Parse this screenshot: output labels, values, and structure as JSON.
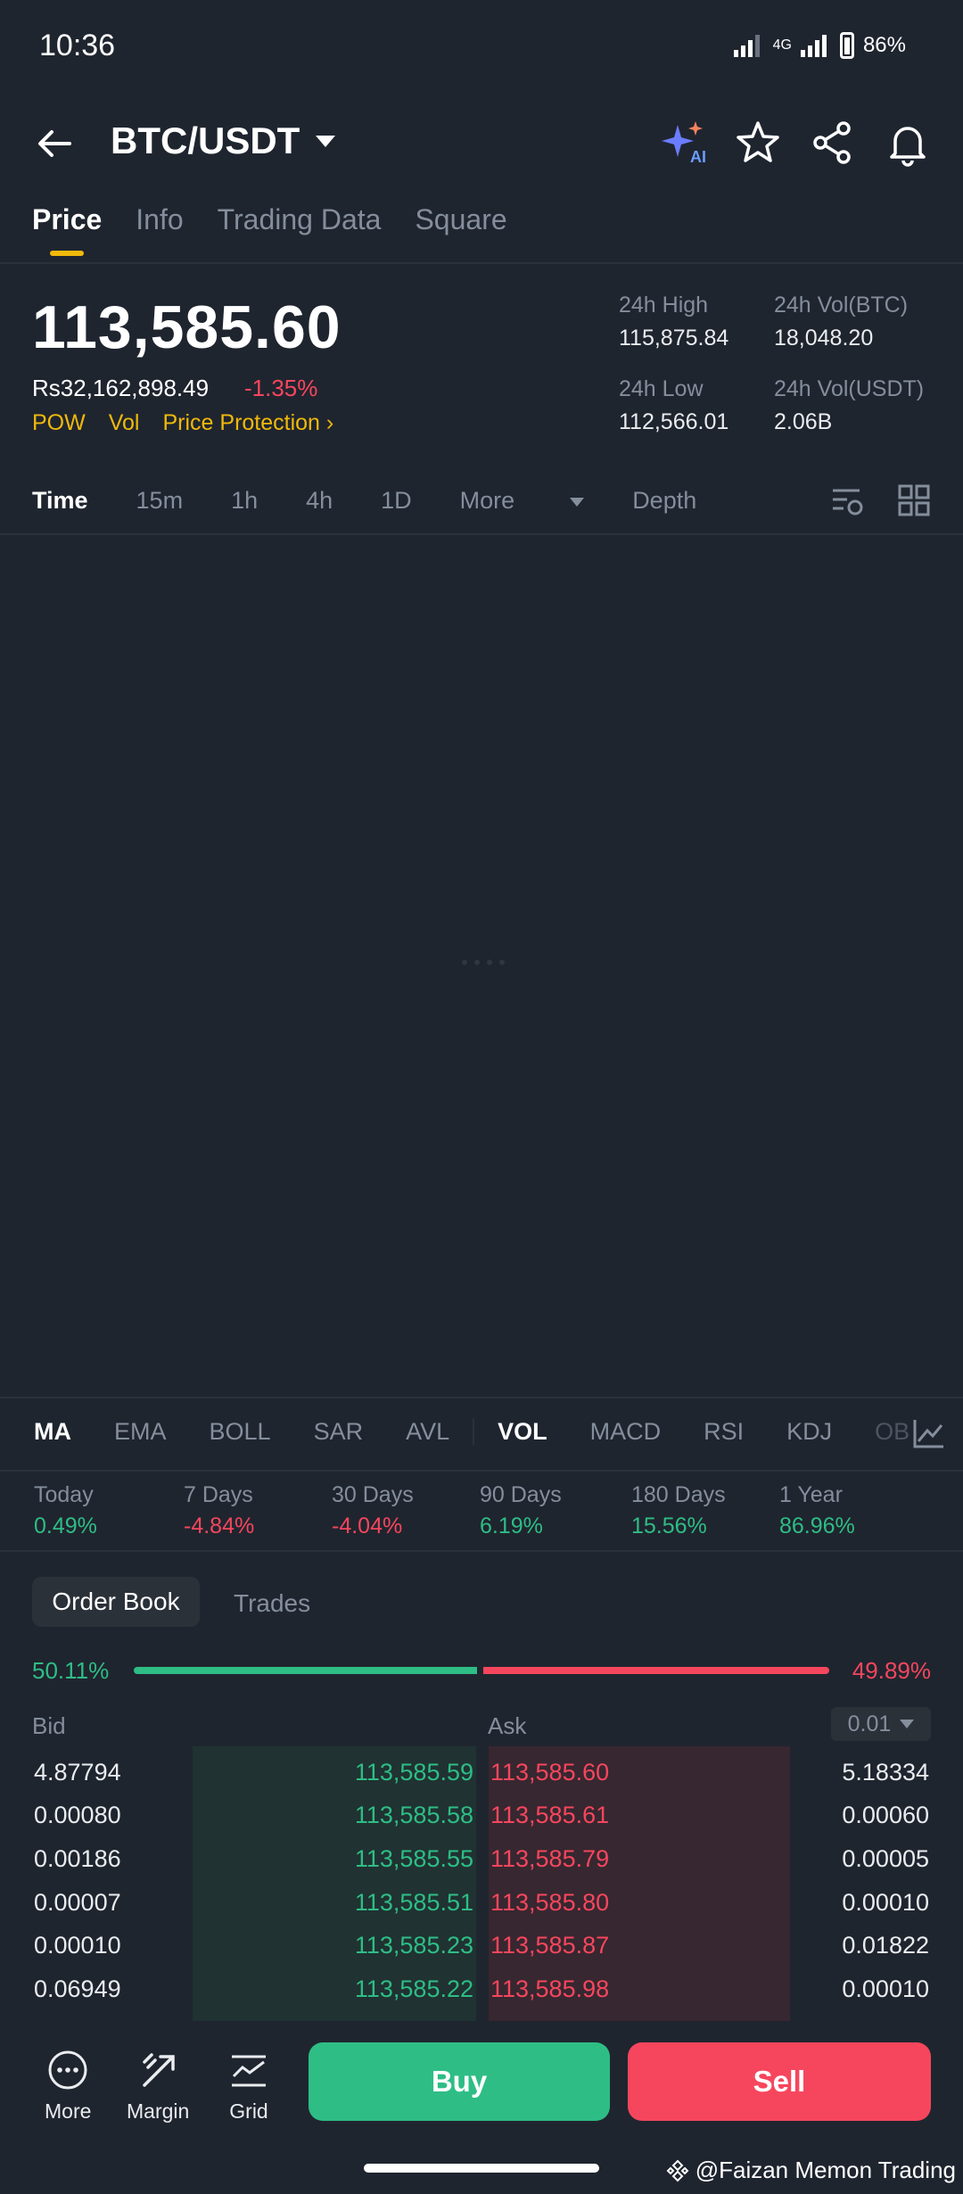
{
  "status_bar": {
    "time": "10:36",
    "network": "4G",
    "battery": "86%"
  },
  "header": {
    "pair": "BTC/USDT",
    "icons": [
      "back-arrow-icon",
      "ai-sparkle-icon",
      "star-icon",
      "share-icon",
      "bell-icon"
    ]
  },
  "tabs": [
    {
      "label": "Price",
      "active": true
    },
    {
      "label": "Info"
    },
    {
      "label": "Trading Data"
    },
    {
      "label": "Square"
    }
  ],
  "price": {
    "last": "113,585.60",
    "fiat": "Rs32,162,898.49",
    "change": "-1.35%",
    "tags": [
      "POW",
      "Vol",
      "Price Protection"
    ]
  },
  "stats": {
    "high_label": "24h High",
    "high": "115,875.84",
    "low_label": "24h Low",
    "low": "112,566.01",
    "vol_btc_label": "24h Vol(BTC)",
    "vol_btc": "18,048.20",
    "vol_usdt_label": "24h Vol(USDT)",
    "vol_usdt": "2.06B"
  },
  "intervals": {
    "time": "Time",
    "m15": "15m",
    "h1": "1h",
    "h4": "4h",
    "d1": "1D",
    "more": "More",
    "depth": "Depth"
  },
  "indicators": {
    "ma": "MA",
    "ema": "EMA",
    "boll": "BOLL",
    "sar": "SAR",
    "avl": "AVL",
    "vol": "VOL",
    "macd": "MACD",
    "rsi": "RSI",
    "kdj": "KDJ",
    "ob": "OB"
  },
  "performance": [
    {
      "label": "Today",
      "value": "0.49%"
    },
    {
      "label": "7 Days",
      "value": "-4.84%"
    },
    {
      "label": "30 Days",
      "value": "-4.04%"
    },
    {
      "label": "90 Days",
      "value": "6.19%"
    },
    {
      "label": "180 Days",
      "value": "15.56%"
    },
    {
      "label": "1 Year",
      "value": "86.96%"
    }
  ],
  "order_book": {
    "tab_active": "Order Book",
    "tab_other": "Trades",
    "bid_ratio": "50.11%",
    "ask_ratio": "49.89%",
    "bid_label": "Bid",
    "ask_label": "Ask",
    "precision": "0.01",
    "rows": [
      {
        "bid_qty": "4.87794",
        "bid_price": "113,585.59",
        "ask_price": "113,585.60",
        "ask_qty": "5.18334"
      },
      {
        "bid_qty": "0.00080",
        "bid_price": "113,585.58",
        "ask_price": "113,585.61",
        "ask_qty": "0.00060"
      },
      {
        "bid_qty": "0.00186",
        "bid_price": "113,585.55",
        "ask_price": "113,585.79",
        "ask_qty": "0.00005"
      },
      {
        "bid_qty": "0.00007",
        "bid_price": "113,585.51",
        "ask_price": "113,585.80",
        "ask_qty": "0.00010"
      },
      {
        "bid_qty": "0.00010",
        "bid_price": "113,585.23",
        "ask_price": "113,585.87",
        "ask_qty": "0.01822"
      },
      {
        "bid_qty": "0.06949",
        "bid_price": "113,585.22",
        "ask_price": "113,585.98",
        "ask_qty": "0.00010"
      }
    ]
  },
  "bottom_bar": {
    "more": "More",
    "margin": "Margin",
    "grid": "Grid",
    "buy": "Buy",
    "sell": "Sell"
  },
  "watermark": "@Faizan Memon Trading",
  "colors": {
    "background": "#1f252f",
    "accent": "#f0b90b",
    "buy": "#2ebd85",
    "sell": "#f6465d"
  }
}
